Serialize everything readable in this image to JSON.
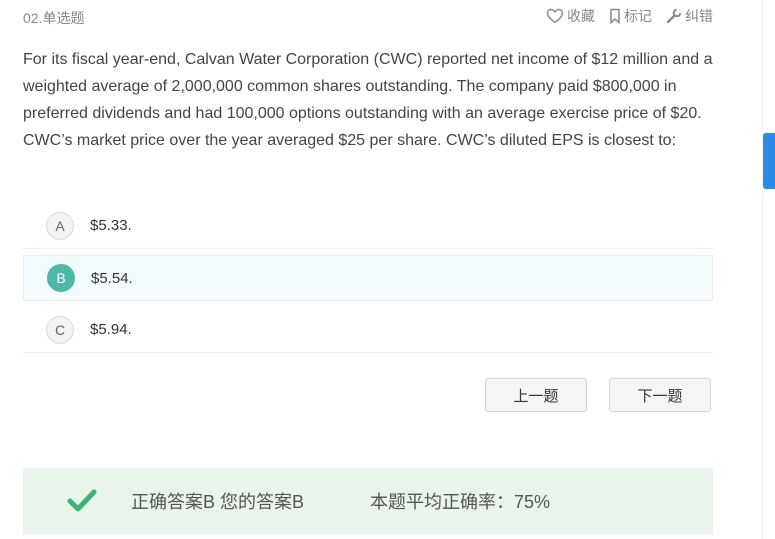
{
  "header": {
    "question_type": "02.单选题",
    "favorite_label": "收藏",
    "mark_label": "标记",
    "report_label": "纠错"
  },
  "question": {
    "text": "For its fiscal year-end, Calvan Water Corporation (CWC) reported net income of $12 million and a weighted average of 2,000,000 common shares outstanding. The company paid $800,000 in preferred dividends and had 100,000 options outstanding with an average exercise price of $20. CWC’s market price over the year averaged $25 per share. CWC’s diluted EPS is closest to:"
  },
  "options": [
    {
      "letter": "A",
      "text": "$5.33."
    },
    {
      "letter": "B",
      "text": "$5.54."
    },
    {
      "letter": "C",
      "text": "$5.94."
    }
  ],
  "selected_option": "B",
  "nav": {
    "prev_label": "上一题",
    "next_label": "下一题"
  },
  "result": {
    "answer_text": "正确答案B 您的答案B",
    "rate_text": "本题平均正确率：75%"
  },
  "colors": {
    "accent_teal": "#4db8a6",
    "answer_bg": "#e9f5eb",
    "check_green": "#3cb371",
    "side_tab": "#2b8be6"
  },
  "icons": {
    "favorite": "heart-icon",
    "mark": "bookmark-icon",
    "report": "wrench-icon",
    "result": "checkmark-icon"
  }
}
